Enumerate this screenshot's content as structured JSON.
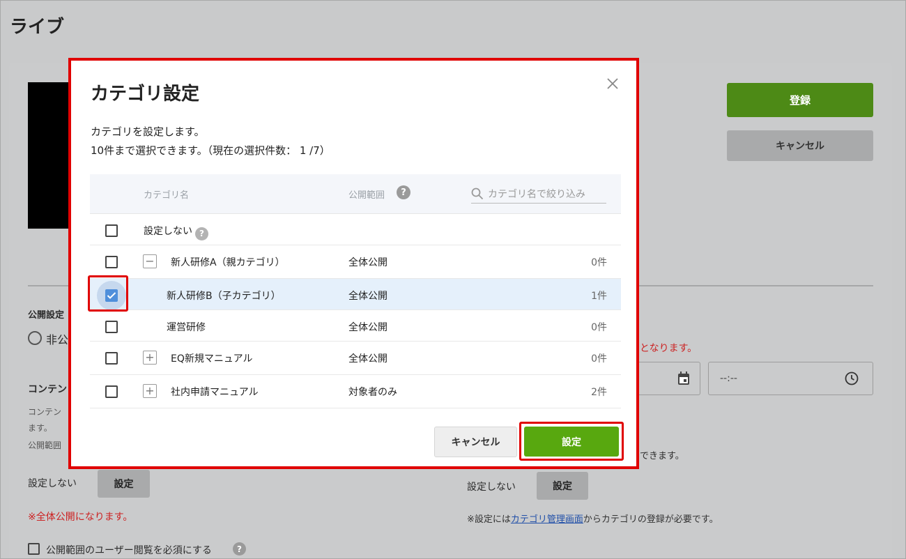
{
  "page": {
    "title": "ライブ",
    "register_label": "登録",
    "cancel_label": "キャンセル",
    "publish_setting_label": "公開設定",
    "radio_private_label": "非公",
    "content_heading": "コンテン",
    "content_note_1": "コンテン",
    "content_note_2": "ます。",
    "content_note_3": "公開範囲",
    "no_setting_left": "設定しない",
    "set_button_left": "設定",
    "public_warning": "※全体公開になります。",
    "required_view_checkbox": "公開範囲のユーザー閲覧を必須にする",
    "right_warning": "となります。",
    "time_placeholder": "--:--",
    "right_note": "できます。",
    "no_setting_right": "設定しない",
    "set_button_right": "設定",
    "category_note_prefix": "※設定には",
    "category_note_link": "カテゴリ管理画面",
    "category_note_suffix": "からカテゴリの登録が必要です。"
  },
  "modal": {
    "title": "カテゴリ設定",
    "close_icon": "close-icon",
    "description_1": "カテゴリを設定します。",
    "description_2": "10件まで選択できます。（現在の選択件数： 1 /7）",
    "columns": {
      "name": "カテゴリ名",
      "range": "公開範囲",
      "search_placeholder": "カテゴリ名で絞り込み"
    },
    "rows": [
      {
        "name": "設定しない",
        "range": "",
        "count": "",
        "checked": false,
        "toggle": ""
      },
      {
        "name": "新人研修A（親カテゴリ）",
        "range": "全体公開",
        "count": "0件",
        "checked": false,
        "toggle": "−"
      },
      {
        "name": "新人研修B（子カテゴリ）",
        "range": "全体公開",
        "count": "1件",
        "checked": true,
        "toggle": ""
      },
      {
        "name": "運営研修",
        "range": "全体公開",
        "count": "0件",
        "checked": false,
        "toggle": ""
      },
      {
        "name": "EQ新規マニュアル",
        "range": "全体公開",
        "count": "0件",
        "checked": false,
        "toggle": "+"
      },
      {
        "name": "社内申請マニュアル",
        "range": "対象者のみ",
        "count": "2件",
        "checked": false,
        "toggle": "+"
      }
    ],
    "cancel_label": "キャンセル",
    "submit_label": "設定"
  },
  "colors": {
    "accent_green": "#58a80f",
    "highlight_red": "#e00000",
    "selected_row": "#e5f0fb",
    "checkbox_blue": "#4f8fdb"
  }
}
